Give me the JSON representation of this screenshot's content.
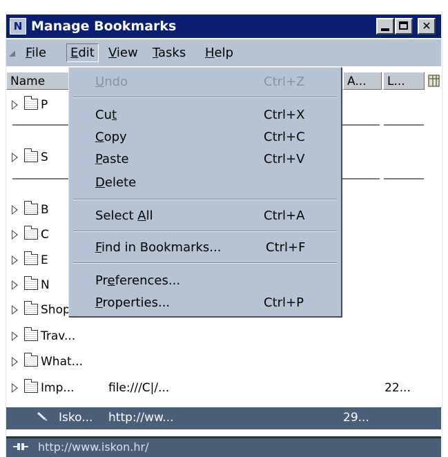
{
  "window": {
    "title": "Manage Bookmarks",
    "app_icon_letter": "N",
    "buttons": {
      "minimize_icon": "minimize-icon",
      "maximize_icon": "maximize-icon",
      "close_icon": "close-icon"
    }
  },
  "menubar": {
    "items": [
      {
        "label": "File",
        "mnemonic": "F"
      },
      {
        "label": "Edit",
        "mnemonic": "E",
        "active": true
      },
      {
        "label": "View",
        "mnemonic": "V"
      },
      {
        "label": "Tasks",
        "mnemonic": "T"
      },
      {
        "label": "Help",
        "mnemonic": "H"
      }
    ]
  },
  "columns": {
    "name": "Name",
    "added": "A...",
    "last": "L...",
    "picker_icon": "column-picker-icon"
  },
  "tree": {
    "rows": [
      {
        "name": "P",
        "type": "folder"
      },
      {
        "name": "S",
        "type": "folder"
      },
      {
        "name": "B",
        "type": "folder"
      },
      {
        "name": "C",
        "type": "folder"
      },
      {
        "name": "E",
        "type": "folder"
      },
      {
        "name": "N",
        "type": "folder"
      },
      {
        "name": "Shopp",
        "type": "folder"
      },
      {
        "name": "Trav...",
        "type": "folder"
      },
      {
        "name": "What...",
        "type": "folder"
      },
      {
        "name": "Imp...",
        "location": "file:///C|/...",
        "last": "22...",
        "type": "folder"
      },
      {
        "name": "Isko...",
        "location": "http://ww...",
        "added": "29...",
        "type": "bookmark",
        "selected": true
      }
    ]
  },
  "edit_menu": {
    "items": [
      {
        "label": "Undo",
        "u": "U",
        "shortcut": "Ctrl+Z",
        "disabled": true
      },
      {
        "label": "Cut",
        "u": "t",
        "shortcut": "Ctrl+X"
      },
      {
        "label": "Copy",
        "u": "C",
        "shortcut": "Ctrl+C"
      },
      {
        "label": "Paste",
        "u": "P",
        "shortcut": "Ctrl+V"
      },
      {
        "label": "Delete",
        "u": "D",
        "shortcut": ""
      },
      {
        "label": "Select All",
        "u": "A",
        "shortcut": "Ctrl+A"
      },
      {
        "label": "Find in Bookmarks...",
        "u": "F",
        "shortcut": "Ctrl+F"
      },
      {
        "label": "Preferences...",
        "u": "e",
        "shortcut": ""
      },
      {
        "label": "Properties...",
        "u": "P",
        "shortcut": "Ctrl+P"
      }
    ]
  },
  "status": {
    "url": "http://www.iskon.hr/",
    "icon": "connection-icon"
  },
  "colors": {
    "titlebar": "#0a1e72",
    "menubar": "#b6c3d4",
    "selection": "#4a5e79"
  }
}
